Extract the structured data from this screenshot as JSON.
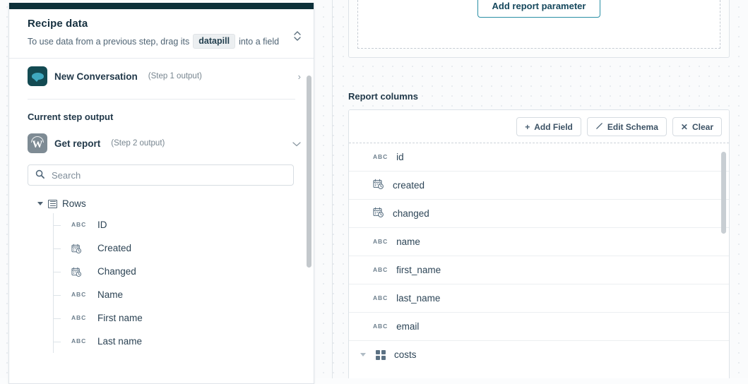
{
  "sidebar": {
    "title": "Recipe data",
    "subtitle_before": "To use data from a previous step, drag its",
    "datapill_label": "datapill",
    "subtitle_after": "into a field",
    "collapse_icon": "chevron-up-down-icon",
    "steps": [
      {
        "name": "New Conversation",
        "output": "(Step 1 output)",
        "icon": "speech-bubble-app-icon",
        "chevron": "chevron-right-icon"
      }
    ],
    "current_step_heading": "Current step output",
    "current_step": {
      "name": "Get report",
      "output": "(Step 2 output)",
      "icon": "workday-app-icon",
      "chevron": "chevron-down-icon"
    },
    "search": {
      "placeholder": "Search",
      "value": "",
      "icon": "search-icon"
    },
    "tree": {
      "group_label": "Rows",
      "group_icon": "list-array-icon",
      "items": [
        {
          "label": "ID",
          "type": "string",
          "icon": "abc-icon"
        },
        {
          "label": "Created",
          "type": "datetime",
          "icon": "calendar-clock-icon"
        },
        {
          "label": "Changed",
          "type": "datetime",
          "icon": "calendar-clock-icon"
        },
        {
          "label": "Name",
          "type": "string",
          "icon": "abc-icon"
        },
        {
          "label": "First name",
          "type": "string",
          "icon": "abc-icon"
        },
        {
          "label": "Last name",
          "type": "string",
          "icon": "abc-icon"
        }
      ]
    }
  },
  "main": {
    "add_report_parameter_label": "Add report parameter",
    "report_columns_heading": "Report columns",
    "toolbar": {
      "add_field_label": "Add Field",
      "add_field_icon": "plus-icon",
      "edit_schema_label": "Edit Schema",
      "edit_schema_icon": "pencil-icon",
      "clear_label": "Clear",
      "clear_icon": "close-x-icon"
    },
    "columns": [
      {
        "label": "id",
        "type": "string",
        "icon": "abc-icon",
        "caret": false
      },
      {
        "label": "created",
        "type": "datetime",
        "icon": "calendar-clock-icon",
        "caret": false
      },
      {
        "label": "changed",
        "type": "datetime",
        "icon": "calendar-clock-icon",
        "caret": false
      },
      {
        "label": "name",
        "type": "string",
        "icon": "abc-icon",
        "caret": false
      },
      {
        "label": "first_name",
        "type": "string",
        "icon": "abc-icon",
        "caret": false
      },
      {
        "label": "last_name",
        "type": "string",
        "icon": "abc-icon",
        "caret": false
      },
      {
        "label": "email",
        "type": "string",
        "icon": "abc-icon",
        "caret": false
      },
      {
        "label": "costs",
        "type": "object",
        "icon": "grid-object-icon",
        "caret": true
      }
    ]
  },
  "colors": {
    "topbar": "#0d3039",
    "accent_teal": "#2a8fa5",
    "text_dark": "#21394a",
    "app_icon_teal": "#134a52",
    "app_icon_gray": "#7e8b94"
  }
}
